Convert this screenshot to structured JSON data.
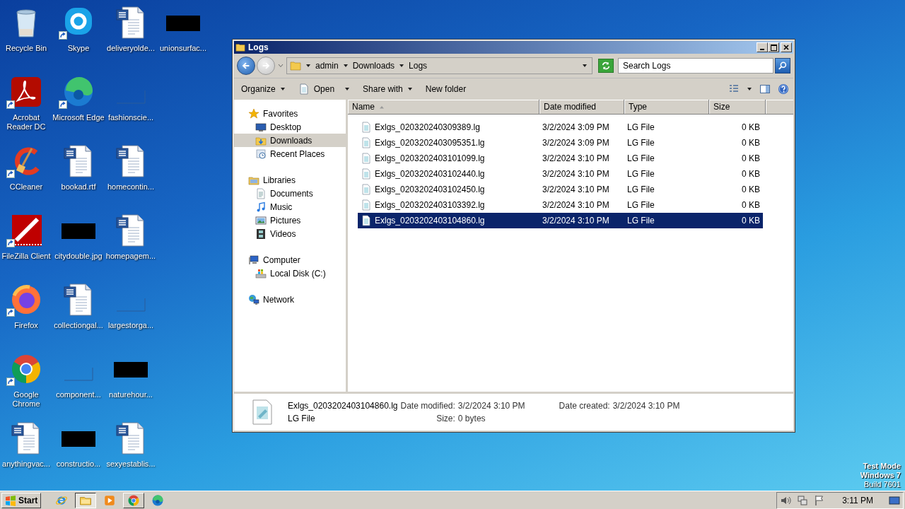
{
  "desktop": {
    "rows": [
      [
        {
          "label": "Recycle Bin",
          "kind": "recycle",
          "shortcut": false
        },
        {
          "label": "Skype",
          "kind": "skype",
          "shortcut": true
        },
        {
          "label": "deliveryolde...",
          "kind": "word",
          "shortcut": false
        },
        {
          "label": "unionsurfac...",
          "kind": "redacted",
          "shortcut": false
        }
      ],
      [
        {
          "label": "Acrobat Reader DC",
          "kind": "acrobat",
          "shortcut": true
        },
        {
          "label": "Microsoft Edge",
          "kind": "edge",
          "shortcut": true
        },
        {
          "label": "fashionscie...",
          "kind": "blank",
          "shortcut": false
        }
      ],
      [
        {
          "label": "CCleaner",
          "kind": "ccleaner",
          "shortcut": true
        },
        {
          "label": "bookad.rtf",
          "kind": "word",
          "shortcut": false
        },
        {
          "label": "homecontin...",
          "kind": "word",
          "shortcut": false
        }
      ],
      [
        {
          "label": "FileZilla Client",
          "kind": "filezilla",
          "shortcut": true
        },
        {
          "label": "citydouble.jpg",
          "kind": "redacted",
          "shortcut": false
        },
        {
          "label": "homepagem...",
          "kind": "word",
          "shortcut": false
        }
      ],
      [
        {
          "label": "Firefox",
          "kind": "firefox",
          "shortcut": true
        },
        {
          "label": "collectiongal...",
          "kind": "word",
          "shortcut": false
        },
        {
          "label": "largestorga...",
          "kind": "blank",
          "shortcut": false
        }
      ],
      [
        {
          "label": "Google Chrome",
          "kind": "chrome",
          "shortcut": true
        },
        {
          "label": "component...",
          "kind": "blank",
          "shortcut": false
        },
        {
          "label": "naturehour...",
          "kind": "redacted",
          "shortcut": false
        }
      ],
      [
        {
          "label": "anythingvac...",
          "kind": "word",
          "shortcut": false
        },
        {
          "label": "constructio...",
          "kind": "redacted",
          "shortcut": false
        },
        {
          "label": "sexyestablis...",
          "kind": "word",
          "shortcut": false
        }
      ]
    ]
  },
  "window": {
    "title": "Logs",
    "address": [
      "admin",
      "Downloads",
      "Logs"
    ],
    "search": {
      "placeholder": "Search Logs"
    },
    "toolbar": [
      {
        "label": "Organize",
        "kind": "menu"
      },
      {
        "label": "Open",
        "kind": "split"
      },
      {
        "label": "Share with",
        "kind": "menu"
      },
      {
        "label": "New folder",
        "kind": "plain"
      }
    ],
    "nav": [
      {
        "label": "Favorites",
        "selected": false,
        "children": [
          {
            "label": "Desktop",
            "selected": false
          },
          {
            "label": "Downloads",
            "selected": true
          },
          {
            "label": "Recent Places",
            "selected": false
          }
        ]
      },
      {
        "label": "Libraries",
        "selected": false,
        "children": [
          {
            "label": "Documents",
            "selected": false
          },
          {
            "label": "Music",
            "selected": false
          },
          {
            "label": "Pictures",
            "selected": false
          },
          {
            "label": "Videos",
            "selected": false
          }
        ]
      },
      {
        "label": "Computer",
        "selected": false,
        "children": [
          {
            "label": "Local Disk (C:)",
            "selected": false
          }
        ]
      },
      {
        "label": "Network",
        "selected": false
      }
    ],
    "columns": [
      {
        "label": "Name",
        "sorted": true
      },
      {
        "label": "Date modified",
        "sorted": false
      },
      {
        "label": "Type",
        "sorted": false
      },
      {
        "label": "Size",
        "sorted": false
      }
    ],
    "files": [
      {
        "name": "Exlgs_020320240309389.lg",
        "date": "3/2/2024 3:09 PM",
        "type": "LG File",
        "size": "0 KB",
        "selected": false
      },
      {
        "name": "Exlgs_0203202403095351.lg",
        "date": "3/2/2024 3:09 PM",
        "type": "LG File",
        "size": "0 KB",
        "selected": false
      },
      {
        "name": "Exlgs_0203202403101099.lg",
        "date": "3/2/2024 3:10 PM",
        "type": "LG File",
        "size": "0 KB",
        "selected": false
      },
      {
        "name": "Exlgs_0203202403102440.lg",
        "date": "3/2/2024 3:10 PM",
        "type": "LG File",
        "size": "0 KB",
        "selected": false
      },
      {
        "name": "Exlgs_0203202403102450.lg",
        "date": "3/2/2024 3:10 PM",
        "type": "LG File",
        "size": "0 KB",
        "selected": false
      },
      {
        "name": "Exlgs_0203202403103392.lg",
        "date": "3/2/2024 3:10 PM",
        "type": "LG File",
        "size": "0 KB",
        "selected": false
      },
      {
        "name": "Exlgs_0203202403104860.lg",
        "date": "3/2/2024 3:10 PM",
        "type": "LG File",
        "size": "0 KB",
        "selected": true
      }
    ],
    "details": {
      "name": "Exlgs_0203202403104860.lg",
      "type": "LG File",
      "modified": {
        "label": "Date modified:",
        "value": "3/2/2024 3:10 PM"
      },
      "created": {
        "label": "Date created:",
        "value": "3/2/2024 3:10 PM"
      },
      "size": {
        "label": "Size:",
        "value": "0 bytes"
      }
    }
  },
  "os_notice": [
    {
      "text": "Test Mode",
      "bold": true
    },
    {
      "text": "Windows 7",
      "bold": true
    },
    {
      "text": "Build 7601",
      "bold": false
    }
  ],
  "taskbar": {
    "start": "Start",
    "apps": [
      {
        "kind": "ie",
        "open": false,
        "selected": false
      },
      {
        "kind": "explorer",
        "open": true,
        "selected": true
      },
      {
        "kind": "media",
        "open": false,
        "selected": false
      },
      {
        "kind": "chrome",
        "open": true,
        "selected": false
      },
      {
        "kind": "edge",
        "open": false,
        "selected": false
      }
    ],
    "clock": "3:11 PM"
  }
}
